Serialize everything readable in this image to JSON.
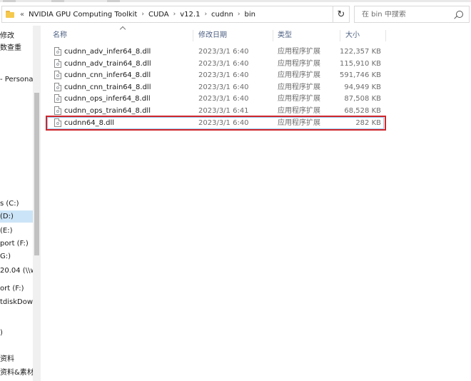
{
  "address_bar": {
    "overflow": "«",
    "crumbs": [
      "NVIDIA GPU Computing Toolkit",
      "CUDA",
      "v12.1",
      "cudnn",
      "bin"
    ],
    "separator": "›"
  },
  "search": {
    "placeholder": "在 bin 中搜索"
  },
  "columns": {
    "name": "名称",
    "date": "修改日期",
    "type": "类型",
    "size": "大小"
  },
  "nav_items": [
    "修改",
    "数查重",
    "- Persona",
    "s (C:)",
    "(D:)",
    "(E:)",
    "port (F:)",
    "G:)",
    "20.04 (\\\\w",
    "ort (F:)",
    "tdiskDow",
    ")",
    "资料",
    "资料&素材"
  ],
  "files": [
    {
      "name": "cudnn_adv_infer64_8.dll",
      "date": "2023/3/1 6:40",
      "type": "应用程序扩展",
      "size": "122,357 KB"
    },
    {
      "name": "cudnn_adv_train64_8.dll",
      "date": "2023/3/1 6:40",
      "type": "应用程序扩展",
      "size": "115,910 KB"
    },
    {
      "name": "cudnn_cnn_infer64_8.dll",
      "date": "2023/3/1 6:40",
      "type": "应用程序扩展",
      "size": "591,746 KB"
    },
    {
      "name": "cudnn_cnn_train64_8.dll",
      "date": "2023/3/1 6:40",
      "type": "应用程序扩展",
      "size": "94,949 KB"
    },
    {
      "name": "cudnn_ops_infer64_8.dll",
      "date": "2023/3/1 6:40",
      "type": "应用程序扩展",
      "size": "87,508 KB"
    },
    {
      "name": "cudnn_ops_train64_8.dll",
      "date": "2023/3/1 6:41",
      "type": "应用程序扩展",
      "size": "68,528 KB"
    },
    {
      "name": "cudnn64_8.dll",
      "date": "2023/3/1 6:40",
      "type": "应用程序扩展",
      "size": "282 KB"
    }
  ],
  "colors": {
    "selected_nav": "#cce4f7",
    "highlight": "#d0262a",
    "header_text": "#4d6082"
  }
}
